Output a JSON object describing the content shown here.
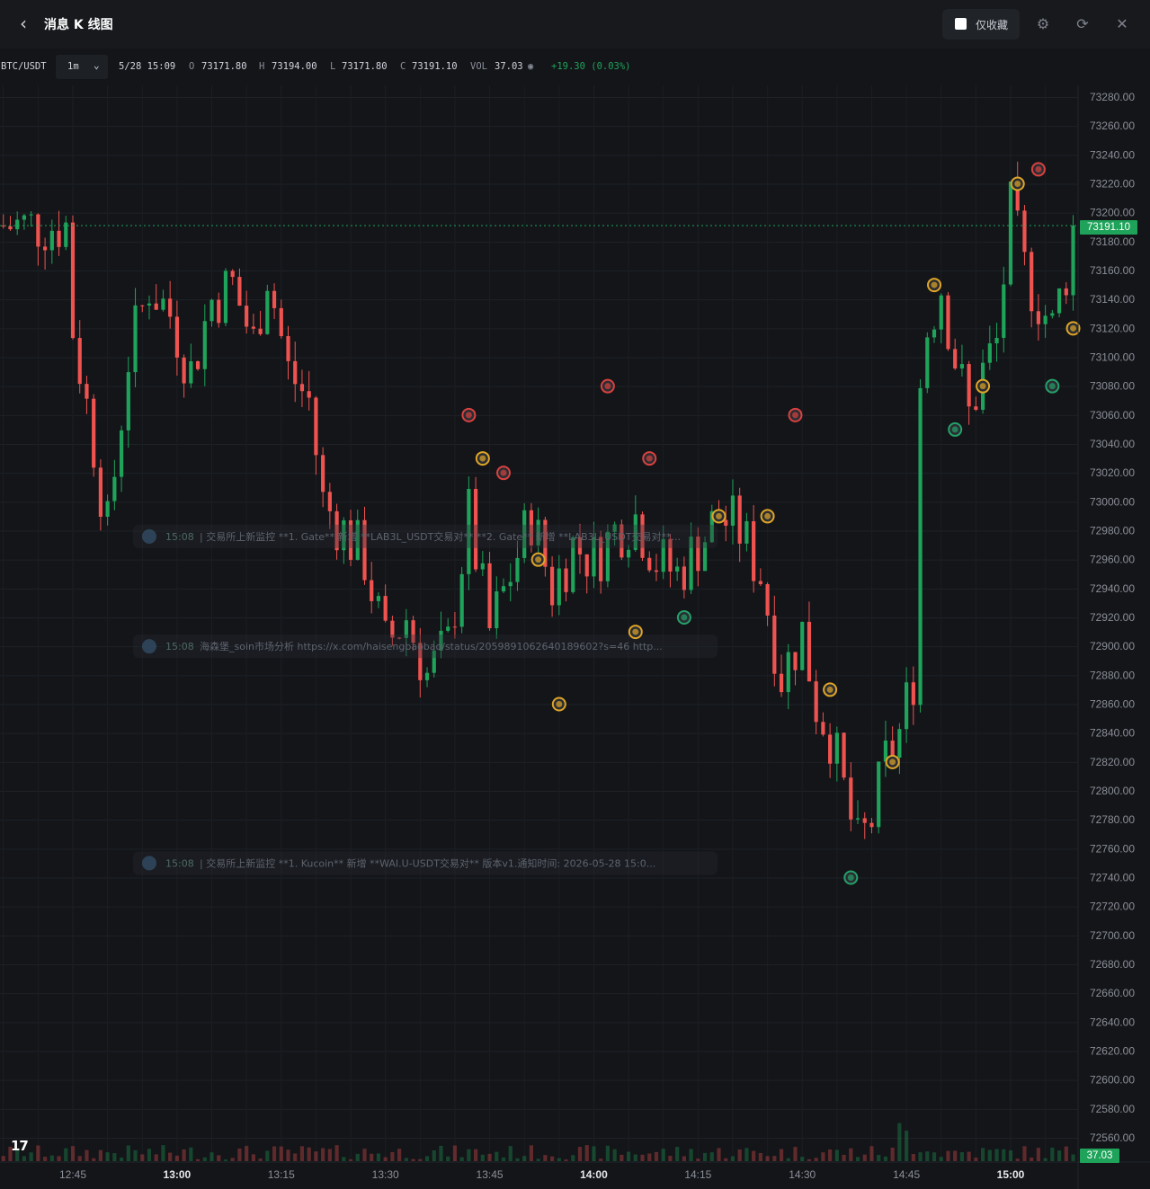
{
  "header": {
    "title": "消息 K 线图",
    "favorites_label": "仅收藏"
  },
  "ticker": {
    "symbol": "BTC/USDT",
    "interval": "1m",
    "datetime": "5/28 15:09",
    "open_label": "O",
    "open": "73171.80",
    "high_label": "H",
    "high": "73194.00",
    "low_label": "L",
    "low": "73171.80",
    "close_label": "C",
    "close": "73191.10",
    "vol_label": "VOL",
    "vol": "37.03",
    "change": "+19.30 (0.03%)"
  },
  "colors": {
    "up": "#1fa35a",
    "down": "#ef5350",
    "marker_gold": "#e0a526",
    "marker_red": "#d9413f",
    "marker_green": "#25a169"
  },
  "logo_text": "17",
  "chart_data": {
    "type": "candlestick",
    "pair": "BTC/USDT",
    "interval": "1m",
    "last_price": "73191.10",
    "last_volume": "37.03",
    "ylim": [
      72540,
      73285
    ],
    "y_ticks": [
      "73280.00",
      "73260.00",
      "73240.00",
      "73220.00",
      "73200.00",
      "73180.00",
      "73160.00",
      "73140.00",
      "73120.00",
      "73100.00",
      "73080.00",
      "73060.00",
      "73040.00",
      "73020.00",
      "73000.00",
      "72980.00",
      "72960.00",
      "72940.00",
      "72920.00",
      "72900.00",
      "72880.00",
      "72860.00",
      "72840.00",
      "72820.00",
      "72800.00",
      "72780.00",
      "72760.00",
      "72740.00",
      "72720.00",
      "72700.00",
      "72680.00",
      "72660.00",
      "72640.00",
      "72620.00",
      "72600.00",
      "72580.00",
      "72560.00"
    ],
    "x_ticks": [
      {
        "label": "12:45",
        "minute": 0,
        "bold": false
      },
      {
        "label": "13:00",
        "minute": 15,
        "bold": true
      },
      {
        "label": "13:15",
        "minute": 30,
        "bold": false
      },
      {
        "label": "13:30",
        "minute": 45,
        "bold": false
      },
      {
        "label": "13:45",
        "minute": 60,
        "bold": false
      },
      {
        "label": "14:00",
        "minute": 75,
        "bold": true
      },
      {
        "label": "14:15",
        "minute": 90,
        "bold": false
      },
      {
        "label": "14:30",
        "minute": 105,
        "bold": false
      },
      {
        "label": "14:45",
        "minute": 120,
        "bold": false
      },
      {
        "label": "15:00",
        "minute": 135,
        "bold": true
      }
    ],
    "anchors": [
      [
        0,
        73120
      ],
      [
        3,
        73040
      ],
      [
        5,
        72980
      ],
      [
        8,
        73100
      ],
      [
        11,
        73150
      ],
      [
        14,
        73130
      ],
      [
        17,
        73090
      ],
      [
        20,
        73140
      ],
      [
        23,
        73150
      ],
      [
        26,
        73110
      ],
      [
        28,
        73160
      ],
      [
        31,
        73090
      ],
      [
        34,
        73070
      ],
      [
        36,
        73000
      ],
      [
        39,
        72980
      ],
      [
        42,
        72960
      ],
      [
        45,
        72900
      ],
      [
        48,
        72920
      ],
      [
        51,
        72880
      ],
      [
        54,
        72900
      ],
      [
        57,
        72990
      ],
      [
        60,
        72910
      ],
      [
        63,
        72950
      ],
      [
        66,
        72990
      ],
      [
        69,
        72940
      ],
      [
        72,
        72970
      ],
      [
        75,
        72960
      ],
      [
        78,
        72980
      ],
      [
        81,
        72990
      ],
      [
        84,
        72960
      ],
      [
        87,
        72950
      ],
      [
        90,
        72970
      ],
      [
        93,
        72990
      ],
      [
        96,
        72980
      ],
      [
        99,
        72950
      ],
      [
        102,
        72880
      ],
      [
        105,
        72910
      ],
      [
        107,
        72860
      ],
      [
        109,
        72840
      ],
      [
        111,
        72800
      ],
      [
        113,
        72760
      ],
      [
        115,
        72780
      ],
      [
        117,
        72820
      ],
      [
        119,
        72840
      ],
      [
        121,
        72880
      ],
      [
        122,
        73080
      ],
      [
        123,
        73120
      ],
      [
        125,
        73150
      ],
      [
        127,
        73100
      ],
      [
        129,
        73060
      ],
      [
        131,
        73090
      ],
      [
        133,
        73110
      ],
      [
        135,
        73200
      ],
      [
        137,
        73160
      ],
      [
        139,
        73140
      ],
      [
        141,
        73120
      ],
      [
        143,
        73160
      ],
      [
        144,
        73191.1
      ]
    ],
    "news_markers": [
      {
        "minute": 57,
        "price": 73060,
        "kind": "red"
      },
      {
        "minute": 59,
        "price": 73030,
        "kind": "gold"
      },
      {
        "minute": 62,
        "price": 73020,
        "kind": "red"
      },
      {
        "minute": 67,
        "price": 72960,
        "kind": "gold"
      },
      {
        "minute": 70,
        "price": 72860,
        "kind": "gold"
      },
      {
        "minute": 77,
        "price": 73080,
        "kind": "red"
      },
      {
        "minute": 81,
        "price": 72910,
        "kind": "gold"
      },
      {
        "minute": 83,
        "price": 73030,
        "kind": "red"
      },
      {
        "minute": 88,
        "price": 72920,
        "kind": "green"
      },
      {
        "minute": 93,
        "price": 72990,
        "kind": "gold"
      },
      {
        "minute": 100,
        "price": 72990,
        "kind": "gold"
      },
      {
        "minute": 104,
        "price": 73060,
        "kind": "red"
      },
      {
        "minute": 109,
        "price": 72870,
        "kind": "gold"
      },
      {
        "minute": 112,
        "price": 72740,
        "kind": "green"
      },
      {
        "minute": 118,
        "price": 72820,
        "kind": "gold"
      },
      {
        "minute": 124,
        "price": 73150,
        "kind": "gold"
      },
      {
        "minute": 127,
        "price": 73050,
        "kind": "green"
      },
      {
        "minute": 131,
        "price": 73080,
        "kind": "gold"
      },
      {
        "minute": 136,
        "price": 73220,
        "kind": "gold"
      },
      {
        "minute": 139,
        "price": 73230,
        "kind": "red"
      },
      {
        "minute": 141,
        "price": 73080,
        "kind": "green"
      },
      {
        "minute": 144,
        "price": 73120,
        "kind": "gold"
      }
    ],
    "news_rows": [
      {
        "price": 72976,
        "time": "15:08",
        "text": "| 交易所上新监控  **1. Gate** 新增 **LAB3L_USDT交易对** **2. Gate** 新增 **LAB3L_USDT交易对**..."
      },
      {
        "price": 72900,
        "time": "15:08",
        "text": "海森堡_soin市场分析  https://x.com/haisengbaobao/status/2059891062640189602?s=46 http..."
      },
      {
        "price": 72750,
        "time": "15:08",
        "text": "| 交易所上新监控  **1. Kucoin** 新增 **WAI.U-USDT交易对** 版本v1.通知时间: 2026-05-28 15:0..."
      }
    ]
  }
}
